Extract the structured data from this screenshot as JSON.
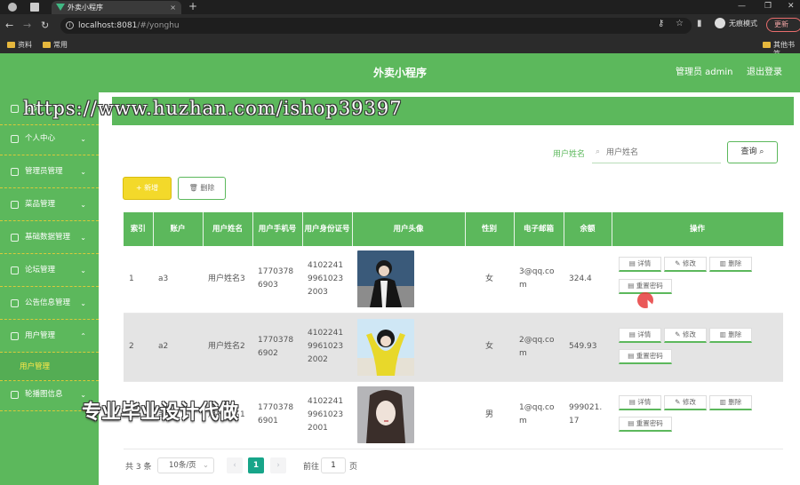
{
  "browser": {
    "tab_title": "外卖小程序",
    "tab_close": "×",
    "new_tab": "+",
    "url_host": "localhost:8081",
    "url_path": "/#/yonghu",
    "incognito_label": "无痕模式",
    "update_label": "更新",
    "bookmarks": [
      "资料",
      "常用"
    ],
    "bookmark_right": "其他书签"
  },
  "header": {
    "title": "外卖小程序",
    "admin": "管理员 admin",
    "logout": "退出登录"
  },
  "watermark": {
    "url_text": "https://www.huzhan.com/ishop39397",
    "slogan": "专业毕业设计代做"
  },
  "sidebar": {
    "items": [
      {
        "label": "首页",
        "has_chevron": false
      },
      {
        "label": "个人中心",
        "has_chevron": true
      },
      {
        "label": "管理员管理",
        "has_chevron": true
      },
      {
        "label": "菜品管理",
        "has_chevron": true
      },
      {
        "label": "基础数据管理",
        "has_chevron": true
      },
      {
        "label": "论坛管理",
        "has_chevron": true
      },
      {
        "label": "公告信息管理",
        "has_chevron": true
      },
      {
        "label": "用户管理",
        "has_chevron": true,
        "expanded": true
      },
      {
        "label": "轮播图信息",
        "has_chevron": true
      }
    ],
    "active_sub": "用户管理",
    "chevron_down": "⌄",
    "chevron_up": "⌃"
  },
  "search": {
    "label": "用户姓名",
    "placeholder": "用户姓名",
    "query_button": "查询"
  },
  "toolbar": {
    "add_label": "+ 新增",
    "delete_label": "删除"
  },
  "table": {
    "columns": [
      "索引",
      "账户",
      "用户姓名",
      "用户手机号",
      "用户身份证号",
      "用户头像",
      "性别",
      "电子邮箱",
      "余额",
      "操作"
    ],
    "rows": [
      {
        "index": "1",
        "account": "a3",
        "name": "用户姓名3",
        "phone": "17703786903",
        "id_card": "410224199610232003",
        "gender": "女",
        "email": "3@qq.com",
        "balance": "324.4"
      },
      {
        "index": "2",
        "account": "a2",
        "name": "用户姓名2",
        "phone": "17703786902",
        "id_card": "410224199610232002",
        "gender": "女",
        "email": "2@qq.com",
        "balance": "549.93"
      },
      {
        "index": "3",
        "account": "a1",
        "name": "用户姓名1",
        "phone": "17703786901",
        "id_card": "410224199610232001",
        "gender": "男",
        "email": "1@qq.com",
        "balance": "999021.17"
      }
    ],
    "actions": {
      "detail": "详情",
      "edit": "修改",
      "delete": "删除",
      "reset_password": "重置密码"
    }
  },
  "pagination": {
    "total": "共 3 条",
    "page_size": "10条/页",
    "current_page": "1",
    "goto_label": "前往",
    "goto_value": "1",
    "goto_unit": "页"
  },
  "colors": {
    "primary": "#5cb85c",
    "add_button": "#f3d92a",
    "active_page": "#17a589",
    "submenu_active": "#ffe94a"
  }
}
